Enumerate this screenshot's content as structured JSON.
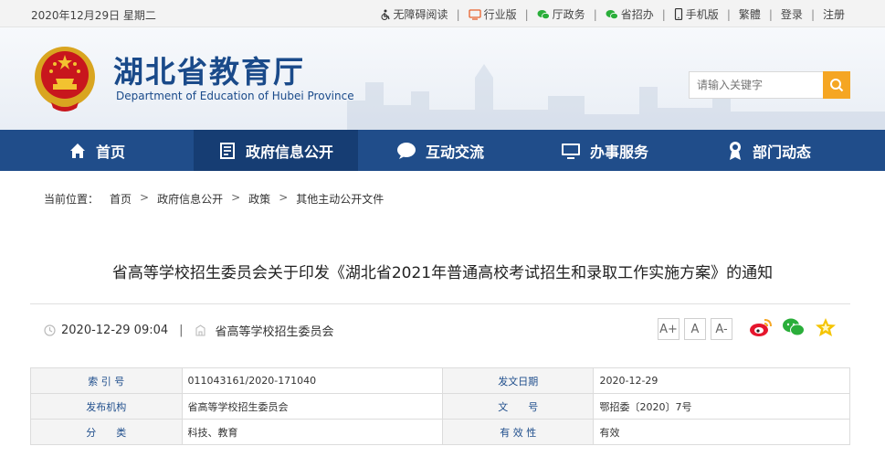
{
  "topbar": {
    "date": "2020年12月29日 星期二",
    "links": [
      {
        "label": "无障碍阅读",
        "icon": "wheelchair-icon"
      },
      {
        "label": "行业版",
        "icon": "monitor-icon"
      },
      {
        "label": "厅政务",
        "icon": "wechat-icon"
      },
      {
        "label": "省招办",
        "icon": "wechat-icon"
      },
      {
        "label": "手机版",
        "icon": "mobile-icon"
      }
    ],
    "lang": "繁體",
    "login": "登录",
    "register": "注册"
  },
  "header": {
    "title": "湖北省教育厅",
    "subtitle": "Department of Education of Hubei Province",
    "search_placeholder": "请输入关键字"
  },
  "nav": [
    {
      "label": "首页",
      "icon": "home-icon"
    },
    {
      "label": "政府信息公开",
      "icon": "document-icon",
      "active": true
    },
    {
      "label": "互动交流",
      "icon": "chat-bubble-icon"
    },
    {
      "label": "办事服务",
      "icon": "monitor-icon"
    },
    {
      "label": "部门动态",
      "icon": "award-icon"
    }
  ],
  "breadcrumb": {
    "prefix": "当前位置：",
    "items": [
      "首页",
      "政府信息公开",
      "政策",
      "其他主动公开文件"
    ],
    "separator": ">"
  },
  "article": {
    "title": "省高等学校招生委员会关于印发《湖北省2021年普通高校考试招生和录取工作实施方案》的通知",
    "datetime": "2020-12-29 09:04",
    "meta_sep": "|",
    "publisher": "省高等学校招生委员会",
    "font_sizes": [
      "A+",
      "A",
      "A-"
    ]
  },
  "info": {
    "rows": [
      {
        "l1": "索 引 号",
        "v1": "011043161/2020-171040",
        "l2": "发文日期",
        "v2": "2020-12-29"
      },
      {
        "l1": "发布机构",
        "v1": "省高等学校招生委员会",
        "l2": "文　　号",
        "v2": "鄂招委〔2020〕7号"
      },
      {
        "l1": "分　　类",
        "v1": "科技、教育",
        "l2": "有 效 性",
        "v2": "有效"
      }
    ]
  },
  "colors": {
    "nav_bg": "#204d8a",
    "nav_active": "#163d73",
    "search_button": "#f5a623",
    "title_blue": "#1a4a8a"
  }
}
